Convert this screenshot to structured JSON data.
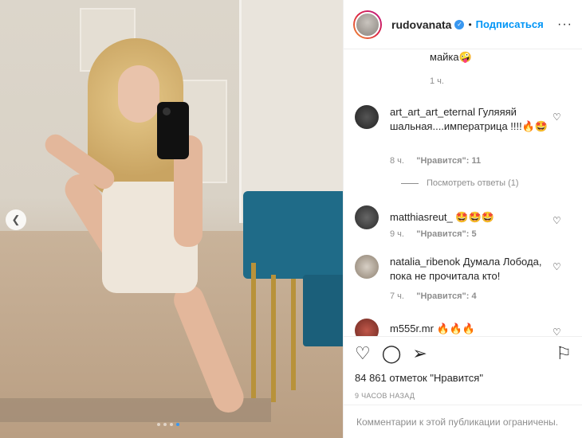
{
  "header": {
    "username": "rudovanata",
    "follow_label": "Подписаться",
    "more_label": "···"
  },
  "partial_comment": {
    "text": "майка🤪",
    "time": "1 ч."
  },
  "comments": [
    {
      "user": "art_art_art_eternal",
      "text": "Гуляяяй шальная....императрица !!!!🔥🤩",
      "time": "8 ч.",
      "likes_label": "\"Нравится\": 11",
      "view_replies": "Посмотреть ответы (1)"
    },
    {
      "user": "matthiasreut_",
      "text": "🤩🤩🤩",
      "time": "9 ч.",
      "likes_label": "\"Нравится\": 5"
    },
    {
      "user": "natalia_ribenok",
      "text": "Думала Лобода, пока не прочитала кто!",
      "time": "7 ч.",
      "likes_label": "\"Нравится\": 4"
    },
    {
      "user": "m555r.mr",
      "text": "🔥🔥🔥"
    }
  ],
  "actions": {
    "likes": "84 861 отметок \"Нравится\"",
    "time": "9 часов назад"
  },
  "footer": {
    "comments_closed": "Комментарии к этой публикации ограничены."
  },
  "carousel": {
    "count": 4,
    "active_index": 3
  },
  "colors": {
    "accent": "#0095f6",
    "muted": "#8e8e8e",
    "text": "#262626"
  }
}
